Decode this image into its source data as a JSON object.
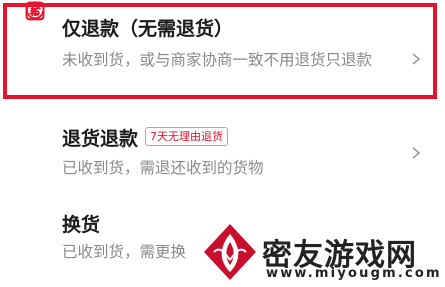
{
  "options": [
    {
      "title": "仅退款（无需退货）",
      "desc": "未收到货，或与商家协商一致不用退货只退款",
      "icon": "yen-refund-icon",
      "selected": true
    },
    {
      "title": "退货退款",
      "tag": "7天无理由退货",
      "desc": "已收到货，需退还收到的货物",
      "icon": "return-box-icon"
    },
    {
      "title": "换货",
      "desc": "已收到货，需更换",
      "icon": "exchange-icon"
    }
  ],
  "watermark": {
    "title": "密友游戏网",
    "url": "www.miyougm.com"
  },
  "colors": {
    "accent": "#e5142d",
    "text": "#1a1a1a",
    "muted": "#8a8a8a"
  }
}
